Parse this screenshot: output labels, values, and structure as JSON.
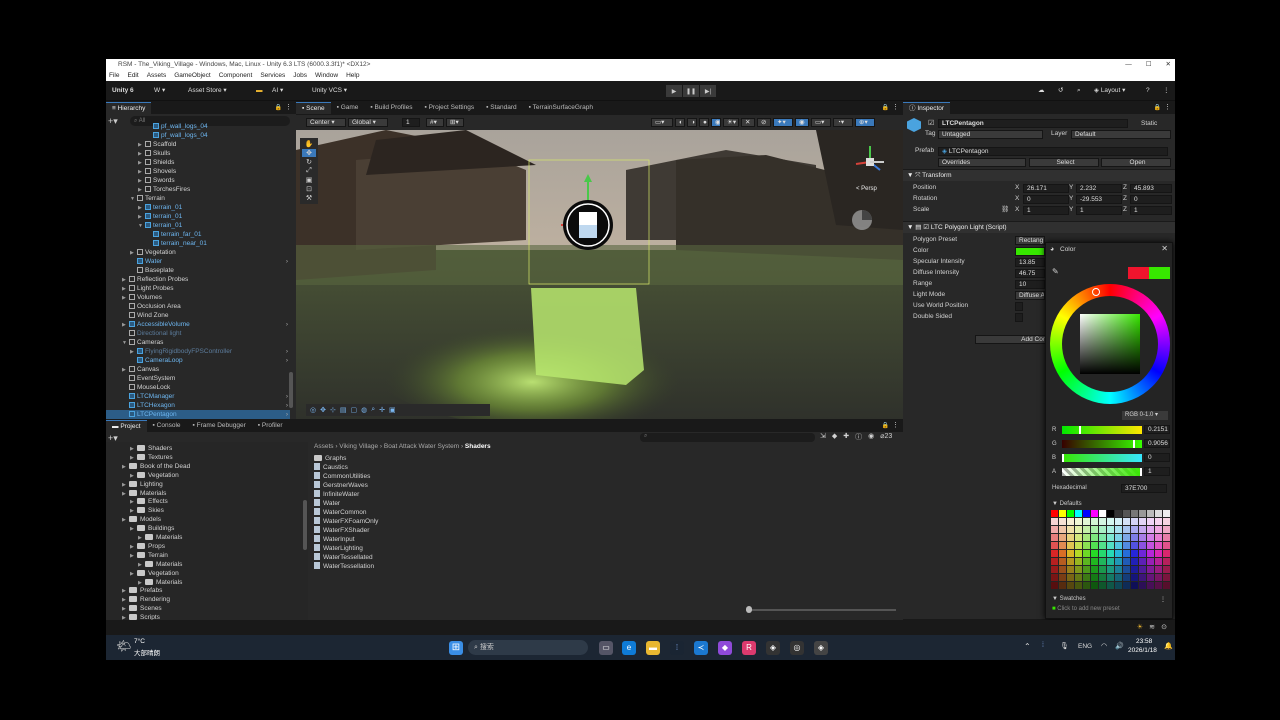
{
  "window": {
    "title": "RSM - The_Viking_Village - Windows, Mac, Linux - Unity 6.3 LTS (6000.3.3f1)* <DX12>"
  },
  "menu": [
    "File",
    "Edit",
    "Assets",
    "GameObject",
    "Component",
    "Services",
    "Jobs",
    "Window",
    "Help"
  ],
  "toolbar": {
    "unity": "Unity 6",
    "account": "W ▾",
    "asset_store": "Asset Store ▾",
    "ai": "AI ▾",
    "vcs": "Unity VCS ▾",
    "layout": "Layout ▾"
  },
  "hierarchy": {
    "tab": "Hierarchy",
    "search_placeholder": "All",
    "rows": [
      {
        "label": "pf_wall_logs_04",
        "indent": 4,
        "blue": true,
        "arrow": ""
      },
      {
        "label": "pf_wall_logs_04",
        "indent": 4,
        "blue": true,
        "arrow": ""
      },
      {
        "label": "Scaffold",
        "indent": 3,
        "blue": false,
        "arrow": "▶"
      },
      {
        "label": "Skulls",
        "indent": 3,
        "blue": false,
        "arrow": "▶"
      },
      {
        "label": "Shields",
        "indent": 3,
        "blue": false,
        "arrow": "▶"
      },
      {
        "label": "Shovels",
        "indent": 3,
        "blue": false,
        "arrow": "▶"
      },
      {
        "label": "Swords",
        "indent": 3,
        "blue": false,
        "arrow": "▶"
      },
      {
        "label": "TorchesFires",
        "indent": 3,
        "blue": false,
        "arrow": "▶"
      },
      {
        "label": "Terrain",
        "indent": 2,
        "blue": false,
        "arrow": "▼"
      },
      {
        "label": "terrain_01",
        "indent": 3,
        "blue": true,
        "arrow": "▶"
      },
      {
        "label": "terrain_01",
        "indent": 3,
        "blue": true,
        "arrow": "▶"
      },
      {
        "label": "terrain_01",
        "indent": 3,
        "blue": true,
        "arrow": "▼"
      },
      {
        "label": "terrain_far_01",
        "indent": 4,
        "blue": true,
        "arrow": ""
      },
      {
        "label": "terrain_near_01",
        "indent": 4,
        "blue": true,
        "arrow": ""
      },
      {
        "label": "Vegetation",
        "indent": 2,
        "blue": false,
        "arrow": "▶"
      },
      {
        "label": "Water",
        "indent": 2,
        "blue": true,
        "arrow": ""
      },
      {
        "label": "Baseplate",
        "indent": 2,
        "blue": false,
        "arrow": ""
      },
      {
        "label": "Reflection Probes",
        "indent": 1,
        "blue": false,
        "arrow": "▶"
      },
      {
        "label": "Light Probes",
        "indent": 1,
        "blue": false,
        "arrow": "▶"
      },
      {
        "label": "Volumes",
        "indent": 1,
        "blue": false,
        "arrow": "▶"
      },
      {
        "label": "Occlusion Area",
        "indent": 1,
        "blue": false,
        "arrow": ""
      },
      {
        "label": "Wind Zone",
        "indent": 1,
        "blue": false,
        "arrow": ""
      },
      {
        "label": "AccessibleVolume",
        "indent": 1,
        "blue": true,
        "arrow": "▶"
      },
      {
        "label": "Directional light",
        "indent": 1,
        "blue": false,
        "arrow": "",
        "dim": true
      },
      {
        "label": "Cameras",
        "indent": 1,
        "blue": false,
        "arrow": "▼"
      },
      {
        "label": "FlyingRigidbodyFPSController",
        "indent": 2,
        "blue": true,
        "arrow": "▶",
        "dim": true
      },
      {
        "label": "CameraLoop",
        "indent": 2,
        "blue": true,
        "arrow": ""
      },
      {
        "label": "Canvas",
        "indent": 1,
        "blue": false,
        "arrow": "▶"
      },
      {
        "label": "EventSystem",
        "indent": 1,
        "blue": false,
        "arrow": ""
      },
      {
        "label": "MouseLock",
        "indent": 1,
        "blue": false,
        "arrow": ""
      },
      {
        "label": "LTCManager",
        "indent": 1,
        "blue": true,
        "arrow": ""
      },
      {
        "label": "LTCHexagon",
        "indent": 1,
        "blue": true,
        "arrow": ""
      },
      {
        "label": "LTCPentagon",
        "indent": 1,
        "blue": true,
        "arrow": "",
        "selected": true
      }
    ]
  },
  "scene_tabs": [
    "Scene",
    "Game",
    "Build Profiles",
    "Project Settings",
    "Standard",
    "TerrainSurfaceGraph"
  ],
  "scene_toolbar": {
    "pivot": "Center ▾",
    "space": "Global ▾",
    "grid": "1"
  },
  "scene_view": {
    "persp": "< Persp"
  },
  "bottom_tabs": [
    "Project",
    "Console",
    "Frame Debugger",
    "Profiler"
  ],
  "project_tree": [
    {
      "label": "Shaders",
      "indent": 1
    },
    {
      "label": "Textures",
      "indent": 1
    },
    {
      "label": "Book of the Dead",
      "indent": 0
    },
    {
      "label": "Vegetation",
      "indent": 1
    },
    {
      "label": "Lighting",
      "indent": 0
    },
    {
      "label": "Materials",
      "indent": 0
    },
    {
      "label": "Effects",
      "indent": 1
    },
    {
      "label": "Skies",
      "indent": 1
    },
    {
      "label": "Models",
      "indent": 0
    },
    {
      "label": "Buildings",
      "indent": 1
    },
    {
      "label": "Materials",
      "indent": 2
    },
    {
      "label": "Props",
      "indent": 1
    },
    {
      "label": "Terrain",
      "indent": 1
    },
    {
      "label": "Materials",
      "indent": 2
    },
    {
      "label": "Vegetation",
      "indent": 1
    },
    {
      "label": "Materials",
      "indent": 2
    },
    {
      "label": "Prefabs",
      "indent": 0
    },
    {
      "label": "Rendering",
      "indent": 0
    },
    {
      "label": "Scenes",
      "indent": 0
    },
    {
      "label": "Scripts",
      "indent": 0
    }
  ],
  "breadcrumb": [
    "Assets",
    "Viking Village",
    "Boat Attack Water System",
    "Shaders"
  ],
  "project_count": "23",
  "project_files": [
    {
      "label": "Graphs",
      "folder": true
    },
    {
      "label": "Caustics"
    },
    {
      "label": "CommonUtilities"
    },
    {
      "label": "GerstnerWaves"
    },
    {
      "label": "InfiniteWater"
    },
    {
      "label": "Water"
    },
    {
      "label": "WaterCommon"
    },
    {
      "label": "WaterFXFoamOnly"
    },
    {
      "label": "WaterFXShader"
    },
    {
      "label": "WaterInput"
    },
    {
      "label": "WaterLighting"
    },
    {
      "label": "WaterTessellated"
    },
    {
      "label": "WaterTessellation"
    }
  ],
  "inspector": {
    "tab": "Inspector",
    "name": "LTCPentagon",
    "static": "Static",
    "tag_label": "Tag",
    "tag": "Untagged",
    "layer_label": "Layer",
    "layer": "Default",
    "prefab_label": "Prefab",
    "prefab": "LTCPentagon",
    "overrides": "Overrides",
    "select": "Select",
    "open": "Open",
    "transform": "Transform",
    "position_label": "Position",
    "position": {
      "x": "26.171",
      "y": "2.232",
      "z": "45.893"
    },
    "rotation_label": "Rotation",
    "rotation": {
      "x": "0",
      "y": "-29.553",
      "z": "0"
    },
    "scale_label": "Scale",
    "scale": {
      "x": "1",
      "y": "1",
      "z": "1"
    },
    "script": "LTC Polygon Light (Script)",
    "props": [
      {
        "label": "Polygon Preset",
        "value": "Rectang"
      },
      {
        "label": "Color",
        "value": ""
      },
      {
        "label": "Specular Intensity",
        "value": "13.85"
      },
      {
        "label": "Diffuse Intensity",
        "value": "46.75"
      },
      {
        "label": "Range",
        "value": "10"
      },
      {
        "label": "Light Mode",
        "value": "Diffuse A"
      },
      {
        "label": "Use World Position",
        "value": ""
      },
      {
        "label": "Double Sided",
        "value": ""
      }
    ],
    "add_component": "Add Comp"
  },
  "color_picker": {
    "title": "Color",
    "mode": "RGB 0-1.0 ▾",
    "r": "0.2151",
    "g": "0.9056",
    "b": "0",
    "a": "1",
    "r_frac": 0.2151,
    "g_frac": 0.9056,
    "b_frac": 0,
    "a_frac": 1,
    "hex_label": "Hexadecimal",
    "hex": "37E700",
    "defaults": "Defaults",
    "swatches": "Swatches",
    "add_preset": "Click to add new preset",
    "old_color": "#f0142d",
    "new_color": "#37e700"
  },
  "taskbar": {
    "temp": "7°C",
    "weather": "大部晴朗",
    "search": "搜索",
    "lang": "ENG",
    "time": "23:58",
    "date": "2026/1/18"
  }
}
